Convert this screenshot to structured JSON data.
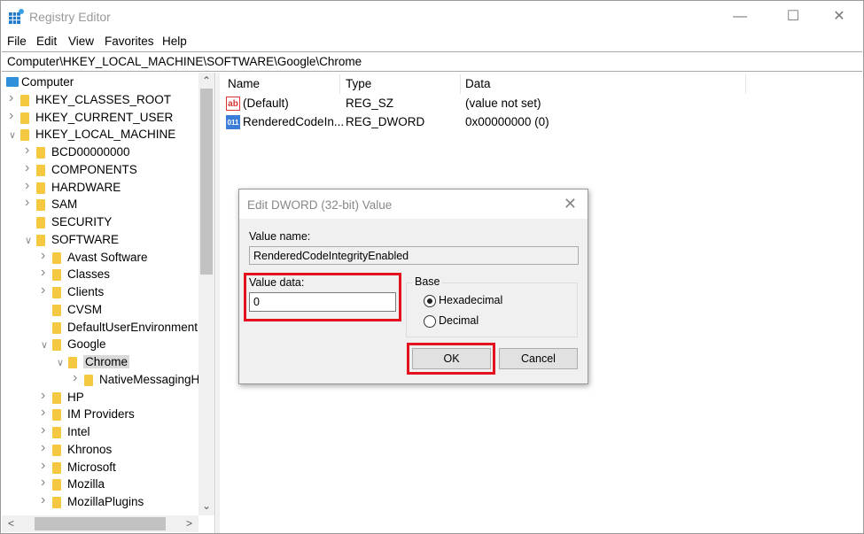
{
  "window": {
    "title": "Registry Editor"
  },
  "menu": [
    "File",
    "Edit",
    "View",
    "Favorites",
    "Help"
  ],
  "address": "Computer\\HKEY_LOCAL_MACHINE\\SOFTWARE\\Google\\Chrome",
  "tree": [
    {
      "label": "Computer",
      "level": -1,
      "chev": ""
    },
    {
      "label": "HKEY_CLASSES_ROOT",
      "level": 0,
      "chev": ">"
    },
    {
      "label": "HKEY_CURRENT_USER",
      "level": 0,
      "chev": ">"
    },
    {
      "label": "HKEY_LOCAL_MACHINE",
      "level": 0,
      "chev": "v"
    },
    {
      "label": "BCD00000000",
      "level": 1,
      "chev": ">"
    },
    {
      "label": "COMPONENTS",
      "level": 1,
      "chev": ">"
    },
    {
      "label": "HARDWARE",
      "level": 1,
      "chev": ">"
    },
    {
      "label": "SAM",
      "level": 1,
      "chev": ">"
    },
    {
      "label": "SECURITY",
      "level": 1,
      "chev": ""
    },
    {
      "label": "SOFTWARE",
      "level": 1,
      "chev": "v"
    },
    {
      "label": "Avast Software",
      "level": 2,
      "chev": ">"
    },
    {
      "label": "Classes",
      "level": 2,
      "chev": ">"
    },
    {
      "label": "Clients",
      "level": 2,
      "chev": ">"
    },
    {
      "label": "CVSM",
      "level": 2,
      "chev": ""
    },
    {
      "label": "DefaultUserEnvironment",
      "level": 2,
      "chev": ""
    },
    {
      "label": "Google",
      "level": 2,
      "chev": "v"
    },
    {
      "label": "Chrome",
      "level": 3,
      "chev": "v",
      "selected": true
    },
    {
      "label": "NativeMessagingHosts",
      "level": 4,
      "chev": ">"
    },
    {
      "label": "HP",
      "level": 2,
      "chev": ">"
    },
    {
      "label": "IM Providers",
      "level": 2,
      "chev": ">"
    },
    {
      "label": "Intel",
      "level": 2,
      "chev": ">"
    },
    {
      "label": "Khronos",
      "level": 2,
      "chev": ">"
    },
    {
      "label": "Microsoft",
      "level": 2,
      "chev": ">"
    },
    {
      "label": "Mozilla",
      "level": 2,
      "chev": ">"
    },
    {
      "label": "MozillaPlugins",
      "level": 2,
      "chev": ">"
    }
  ],
  "list": {
    "headers": [
      "Name",
      "Type",
      "Data"
    ],
    "rows": [
      {
        "icon": "string-value-icon",
        "name": "(Default)",
        "type": "REG_SZ",
        "data": "(value not set)"
      },
      {
        "icon": "dword-value-icon",
        "name": "RenderedCodeIn...",
        "type": "REG_DWORD",
        "data": "0x00000000 (0)"
      }
    ]
  },
  "dialog": {
    "title": "Edit DWORD (32-bit) Value",
    "value_name_label": "Value name:",
    "value_name": "RenderedCodeIntegrityEnabled",
    "value_data_label": "Value data:",
    "value_data": "0",
    "base_label": "Base",
    "hex_label": "Hexadecimal",
    "dec_label": "Decimal",
    "base_selected": "Hexadecimal",
    "ok": "OK",
    "cancel": "Cancel"
  },
  "colors": {
    "highlight": "#e4121f",
    "folder": "#f5c842"
  }
}
